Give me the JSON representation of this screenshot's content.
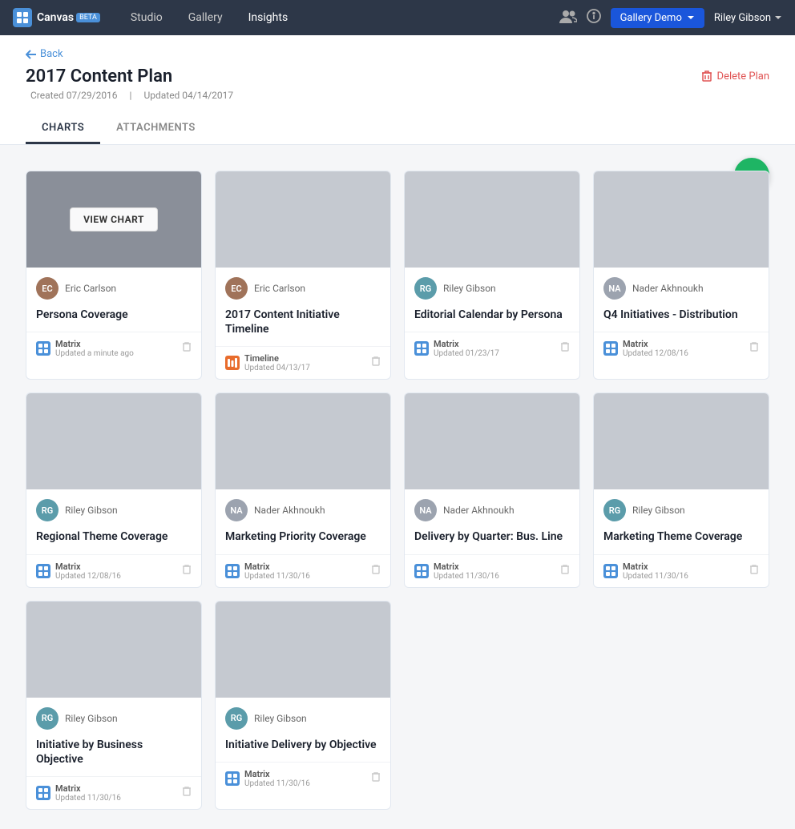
{
  "app": {
    "brand": "Canvas",
    "beta": "BETA",
    "nav_links": [
      "Studio",
      "Gallery",
      "Insights"
    ],
    "active_nav": "Insights",
    "icons": {
      "group": "👥",
      "info": "ℹ️"
    },
    "workspace": "Gallery Demo",
    "user": "Riley Gibson"
  },
  "page": {
    "back_label": "Back",
    "title": "2017 Content Plan",
    "created": "Created 07/29/2016",
    "separator": "|",
    "updated": "Updated 04/14/2017",
    "delete_label": "Delete Plan",
    "tabs": [
      "CHARTS",
      "ATTACHMENTS"
    ],
    "active_tab": "CHARTS"
  },
  "fab_label": "+",
  "cards": [
    {
      "user": "Eric Carlson",
      "user_initials": "EC",
      "user_color": "av-brown",
      "title": "Persona Coverage",
      "hovered": true,
      "type": "Matrix",
      "type_style": "matrix",
      "updated": "Updated a minute ago"
    },
    {
      "user": "Eric Carlson",
      "user_initials": "EC",
      "user_color": "av-brown",
      "title": "2017 Content Initiative Timeline",
      "hovered": false,
      "type": "Timeline",
      "type_style": "timeline",
      "updated": "Updated 04/13/17"
    },
    {
      "user": "Riley Gibson",
      "user_initials": "RG",
      "user_color": "av-teal",
      "title": "Editorial Calendar by Persona",
      "hovered": false,
      "type": "Matrix",
      "type_style": "matrix",
      "updated": "Updated 01/23/17"
    },
    {
      "user": "Nader Akhnoukh",
      "user_initials": "NA",
      "user_color": "av-gray",
      "title": "Q4 Initiatives - Distribution",
      "hovered": false,
      "type": "Matrix",
      "type_style": "matrix",
      "updated": "Updated 12/08/16"
    },
    {
      "user": "Riley Gibson",
      "user_initials": "RG",
      "user_color": "av-teal",
      "title": "Regional Theme Coverage",
      "hovered": false,
      "type": "Matrix",
      "type_style": "matrix",
      "updated": "Updated 12/08/16"
    },
    {
      "user": "Nader Akhnoukh",
      "user_initials": "NA",
      "user_color": "av-gray",
      "title": "Marketing Priority Coverage",
      "hovered": false,
      "type": "Matrix",
      "type_style": "matrix",
      "updated": "Updated 11/30/16"
    },
    {
      "user": "Nader Akhnoukh",
      "user_initials": "NA",
      "user_color": "av-gray",
      "title": "Delivery by Quarter: Bus. Line",
      "hovered": false,
      "type": "Matrix",
      "type_style": "matrix",
      "updated": "Updated 11/30/16"
    },
    {
      "user": "Riley Gibson",
      "user_initials": "RG",
      "user_color": "av-teal",
      "title": "Marketing Theme Coverage",
      "hovered": false,
      "type": "Matrix",
      "type_style": "matrix",
      "updated": "Updated 11/30/16"
    },
    {
      "user": "Riley Gibson",
      "user_initials": "RG",
      "user_color": "av-teal",
      "title": "Initiative by Business Objective",
      "hovered": false,
      "type": "Matrix",
      "type_style": "matrix",
      "updated": "Updated 11/30/16"
    },
    {
      "user": "Riley Gibson",
      "user_initials": "RG",
      "user_color": "av-teal",
      "title": "Initiative Delivery by Objective",
      "hovered": false,
      "type": "Matrix",
      "type_style": "matrix",
      "updated": "Updated 11/30/16"
    }
  ],
  "view_chart_label": "VIEW CHART"
}
